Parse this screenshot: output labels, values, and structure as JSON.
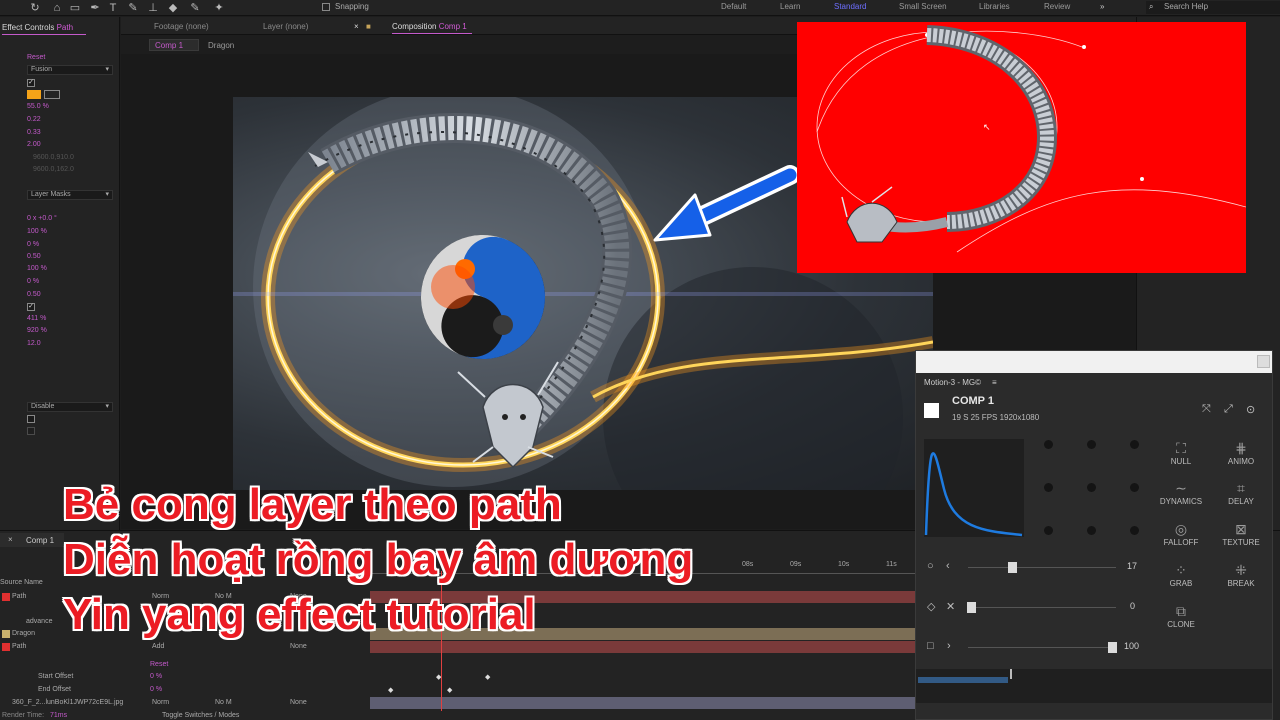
{
  "toolbar": {
    "snapping_label": "Snapping",
    "workspaces": [
      "Default",
      "Learn",
      "Standard",
      "Small Screen",
      "Libraries",
      "Review"
    ],
    "active_workspace": "Standard",
    "search_placeholder": "Search Help"
  },
  "effect_controls": {
    "tab_label": "Effect Controls",
    "tab_layer": "Path",
    "reset": "Reset",
    "mode_dropdown": "Fusion",
    "values": [
      "55.0 %",
      "0.22",
      "0.33",
      "2.00",
      "9600.0,910.0",
      "9600.0,162.0"
    ],
    "layer_masks_dropdown": "Layer Masks",
    "values2": [
      "0 x +0.0 °",
      "100 %",
      "0 %",
      "0.50",
      "100 %",
      "0 %",
      "0.50"
    ],
    "values3": [
      "411 %",
      "920 %",
      "12.0"
    ],
    "disable_dropdown": "Disable"
  },
  "comp_tabs": {
    "footage": "Footage (none)",
    "layer": "Layer (none)",
    "composition_prefix": "Composition",
    "composition_name": "Comp 1",
    "sub_active": "Comp 1",
    "sub_other": "Dragon"
  },
  "timeline": {
    "comp_tab": "Comp 1",
    "source_name_header": "Source Name",
    "rows": [
      {
        "name": "Path",
        "mode": "Norm",
        "trkmat": "No M",
        "parent": "None"
      },
      {
        "name": "advance",
        "mode": "",
        "trkmat": "",
        "parent": ""
      },
      {
        "name": "Dragon",
        "mode": "",
        "trkmat": "",
        "parent": ""
      },
      {
        "name": "Path",
        "mode": "Add",
        "trkmat": "",
        "parent": "None"
      },
      {
        "name": "Start Offset",
        "mode": "",
        "trkmat": "",
        "parent": ""
      },
      {
        "name": "End Offset",
        "mode": "",
        "trkmat": "",
        "parent": ""
      },
      {
        "name": "360_F_2...lunBoKl1JWP72cE9L.jpg",
        "mode": "Norm",
        "trkmat": "No M",
        "parent": "None"
      }
    ],
    "start_offset_val": "0 %",
    "end_offset_val": "0 %",
    "reset": "Reset",
    "ticks": [
      "08s",
      "09s",
      "10s",
      "11s"
    ],
    "render_time_label": "Render Time:",
    "render_time": "71ms",
    "toggle_label": "Toggle Switches / Modes",
    "none_label": "None",
    "add_label": "Add"
  },
  "motion_panel": {
    "title": "Motion-3 - MG©",
    "comp_name": "COMP 1",
    "comp_info": "19 S   25 FPS   1920x1080",
    "buttons": [
      {
        "label": "NULL",
        "icon": "null-icon"
      },
      {
        "label": "ANIMO",
        "icon": "animo-icon"
      },
      {
        "label": "DYNAMICS",
        "icon": "dynamics-icon"
      },
      {
        "label": "DELAY",
        "icon": "delay-icon"
      },
      {
        "label": "FALLOFF",
        "icon": "falloff-icon"
      },
      {
        "label": "TEXTURE",
        "icon": "texture-icon"
      },
      {
        "label": "GRAB",
        "icon": "grab-icon"
      },
      {
        "label": "BREAK",
        "icon": "break-icon"
      },
      {
        "label": "CLONE",
        "icon": "clone-icon"
      }
    ],
    "slider1_value": "17",
    "slider2_value": "0",
    "slider3_value": "100",
    "slider1_level": 0.3,
    "slider2_level": 0.02,
    "slider3_level": 0.97
  },
  "overlay": {
    "line1": "Bẻ cong layer theo path",
    "line2": "Diễn hoạt rồng bay âm dương",
    "line3": "Yin yang effect tutorial"
  },
  "colors": {
    "accent": "#d25bd6",
    "workspace_active": "#6e6fff",
    "overlay_text": "#ec1c24",
    "inset_bg": "#ff0000",
    "arrow": "#1560e8"
  }
}
